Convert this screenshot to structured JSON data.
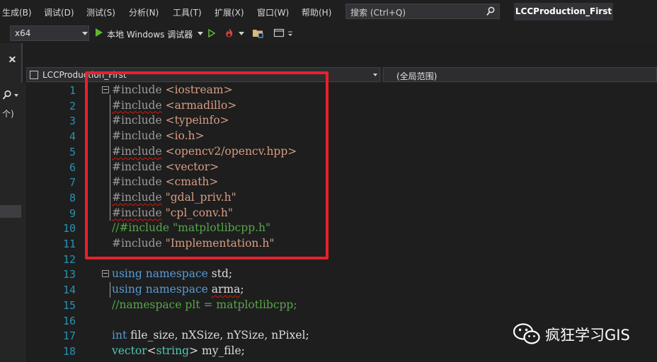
{
  "menu": {
    "items": [
      "生成(B)",
      "调试(D)",
      "测试(S)",
      "分析(N)",
      "工具(T)",
      "扩展(X)",
      "窗口(W)",
      "帮助(H)"
    ]
  },
  "search": {
    "placeholder": "搜索 (Ctrl+Q)"
  },
  "solution_title": "LCCProduction_First",
  "toolbar": {
    "platform": "x64",
    "debugger_label": "本地 Windows 调试器"
  },
  "left_panel": {
    "close_glyph": "✕",
    "count_text": "个)"
  },
  "nav": {
    "file_label": "LCCProduction_First",
    "scope_label": "(全局范围)"
  },
  "editor": {
    "lines": [
      {
        "n": "1"
      },
      {
        "n": "2"
      },
      {
        "n": "3"
      },
      {
        "n": "4"
      },
      {
        "n": "5"
      },
      {
        "n": "6"
      },
      {
        "n": "7"
      },
      {
        "n": "8"
      },
      {
        "n": "9"
      },
      {
        "n": "10"
      },
      {
        "n": "11"
      },
      {
        "n": "12"
      },
      {
        "n": "13"
      },
      {
        "n": "14"
      },
      {
        "n": "15"
      },
      {
        "n": "16"
      },
      {
        "n": "17"
      },
      {
        "n": "18"
      }
    ],
    "code": {
      "l1_a": "#include",
      "l1_b": "<iostream>",
      "l2_a": "#include",
      "l2_b": "<armadillo>",
      "l3_a": "#include",
      "l3_b": "<typeinfo>",
      "l4_a": "#include",
      "l4_b": "<io.h>",
      "l5_a": "#include",
      "l5_b": "<opencv2/opencv.hpp>",
      "l6_a": "#include",
      "l6_b": "<vector>",
      "l7_a": "#include",
      "l7_b": "<cmath>",
      "l8_a": "#include",
      "l8_b": "\"gdal_priv.h\"",
      "l9_a": "#include",
      "l9_b": "\"cpl_conv.h\"",
      "l10": "//#include \"matplotlibcpp.h\"",
      "l11_a": "#include",
      "l11_b": "\"Implementation.h\"",
      "l13_a": "using",
      "l13_b": "namespace",
      "l13_c": "std;",
      "l14_a": "using",
      "l14_b": "namespace",
      "l14_c": "arma",
      "l14_d": ";",
      "l15": "//namespace plt = matplotlibcpp;",
      "l17_a": "int",
      "l17_b": "file_size, nXSize, nYSize, nPixel;",
      "l18_a": "vector",
      "l18_b": "<",
      "l18_c": "string",
      "l18_d": ">",
      "l18_e": "my_file;"
    }
  },
  "watermark": {
    "text": "疯狂学习GIS"
  },
  "colors": {
    "highlight": "#e8212a",
    "keyword": "#569cd6",
    "string": "#d69d85",
    "comment": "#57a64a",
    "line_number": "#2b91af"
  }
}
